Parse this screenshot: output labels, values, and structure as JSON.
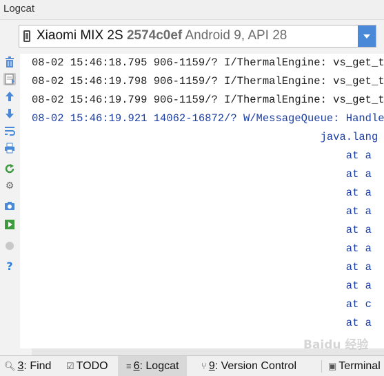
{
  "panel": {
    "title": "Logcat"
  },
  "device": {
    "name": "Xiaomi MIX 2S",
    "serial": "2574c0ef",
    "os": "Android 9, API 28"
  },
  "toolbar": {
    "icons": [
      "trash-icon",
      "scroll-to-end-icon",
      "up-arrow-icon",
      "down-arrow-icon",
      "soft-wrap-icon",
      "print-icon",
      "restart-icon",
      "settings-icon",
      "screenshot-icon",
      "screen-record-icon",
      "stop-icon",
      "help-icon"
    ]
  },
  "log": {
    "lines": [
      {
        "text": "08-02 15:46:18.795 906-1159/? I/ThermalEngine: vs_get_temp",
        "level": "info"
      },
      {
        "text": "08-02 15:46:19.798 906-1159/? I/ThermalEngine: vs_get_temp",
        "level": "info"
      },
      {
        "text": "08-02 15:46:19.799 906-1159/? I/ThermalEngine: vs_get_temp",
        "level": "info"
      },
      {
        "text": "08-02 15:46:19.921 14062-16872/? W/MessageQueue: Handler (",
        "level": "warn"
      },
      {
        "text": "                                             java.lang",
        "level": "warn"
      },
      {
        "text": "                                                 at a",
        "level": "warn"
      },
      {
        "text": "                                                 at a",
        "level": "warn"
      },
      {
        "text": "                                                 at a",
        "level": "warn"
      },
      {
        "text": "                                                 at a",
        "level": "warn"
      },
      {
        "text": "                                                 at a",
        "level": "warn"
      },
      {
        "text": "                                                 at a",
        "level": "warn"
      },
      {
        "text": "                                                 at a",
        "level": "warn"
      },
      {
        "text": "                                                 at a",
        "level": "warn"
      },
      {
        "text": "                                                 at c",
        "level": "warn"
      },
      {
        "text": "                                                 at a",
        "level": "warn"
      }
    ]
  },
  "bottom_tabs": [
    {
      "num": "3",
      "label": ": Find",
      "icon": "search-icon",
      "active": false
    },
    {
      "num": "",
      "label": "TODO",
      "icon": "todo-icon",
      "active": false
    },
    {
      "num": "6",
      "label": ": Logcat",
      "icon": "logcat-icon",
      "active": true
    },
    {
      "num": "9",
      "label": ": Version Control",
      "icon": "version-control-icon",
      "active": false
    },
    {
      "num": "",
      "label": "Terminal",
      "icon": "terminal-icon",
      "active": false
    }
  ],
  "watermark": "Baidu 经验",
  "colors": {
    "accent": "#4a88d8",
    "warn_text": "#1b3ea3",
    "info_text": "#1e1e1e"
  }
}
